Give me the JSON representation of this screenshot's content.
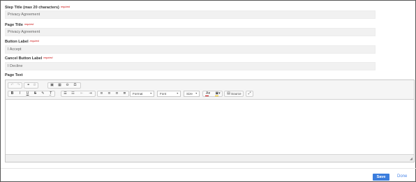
{
  "form": {
    "required_text": "required",
    "step_title": {
      "label": "Step Title (max 20 characters)",
      "value": "Privacy Agreement"
    },
    "page_title": {
      "label": "Page Title",
      "value": "Privacy Agreement"
    },
    "button_label": {
      "label": "Button Label",
      "value": "I Accept"
    },
    "cancel_button_label": {
      "label": "Cancel Button Label",
      "value": "I Decline"
    },
    "page_text": {
      "label": "Page Text"
    }
  },
  "editor": {
    "row1_icons": [
      "undo-icon",
      "redo-icon",
      "link-icon",
      "unlink-icon",
      "image-icon",
      "table-icon",
      "horizontal-line-icon",
      "special-character-icon"
    ],
    "row2_icons": [
      "bold-icon",
      "italic-icon",
      "underline-icon",
      "strikethrough-icon",
      "copy-format-icon",
      "remove-format-icon",
      "numbered-list-icon",
      "bulleted-list-icon",
      "decrease-indent-icon",
      "increase-indent-icon",
      "align-left-icon",
      "align-center-icon",
      "align-right-icon",
      "justify-icon",
      "text-color-icon",
      "background-color-icon",
      "source-icon",
      "maximize-icon"
    ],
    "format_label": "Format",
    "font_label": "Font",
    "size_label": "Size",
    "source_label": "Source",
    "special_char_glyph": "Ω",
    "colors": {
      "text_color": "#cc0000",
      "background_color": "#ffcc00"
    }
  },
  "actions": {
    "save_label": "Save",
    "done_label": "Done"
  },
  "colors": {
    "accent": "#3b7ddd",
    "link": "#4a86e8",
    "required": "#cc1111",
    "field_bg": "#f1f1f1"
  }
}
